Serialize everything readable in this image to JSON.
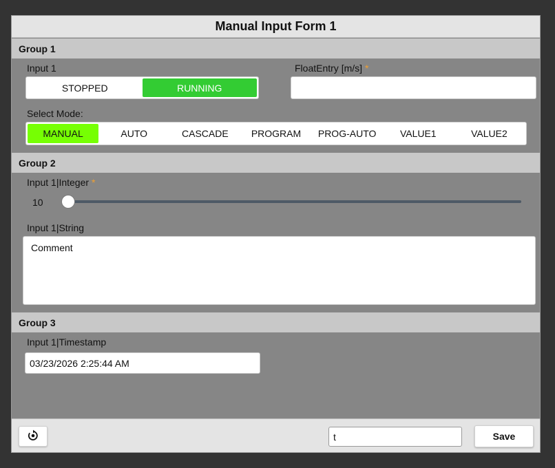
{
  "form": {
    "title": "Manual Input Form 1"
  },
  "group1": {
    "header": "Group 1",
    "input1_label": "Input 1",
    "toggle_options": [
      "STOPPED",
      "RUNNING"
    ],
    "toggle_selected": "RUNNING",
    "float_label": "FloatEntry [m/s]",
    "float_required_mark": "*",
    "float_value": "",
    "mode_label": "Select Mode:",
    "mode_options": [
      "MANUAL",
      "AUTO",
      "CASCADE",
      "PROGRAM",
      "PROG-AUTO",
      "VALUE1",
      "VALUE2"
    ],
    "mode_selected": "MANUAL"
  },
  "group2": {
    "header": "Group 2",
    "integer_label": "Input 1|Integer",
    "integer_required_mark": "*",
    "integer_value": "10",
    "string_label": "Input 1|String",
    "string_value": "Comment"
  },
  "group3": {
    "header": "Group 3",
    "timestamp_label": "Input 1|Timestamp",
    "timestamp_value": "03/23/2026 2:25:44 AM"
  },
  "footer": {
    "reset_icon": "reset-icon",
    "text_value": "t",
    "save_label": "Save"
  },
  "colors": {
    "running_active": "#33cc33",
    "mode_active": "#76ff03",
    "required": "#f0a030",
    "panel": "#868686",
    "header": "#c8c8c8"
  }
}
